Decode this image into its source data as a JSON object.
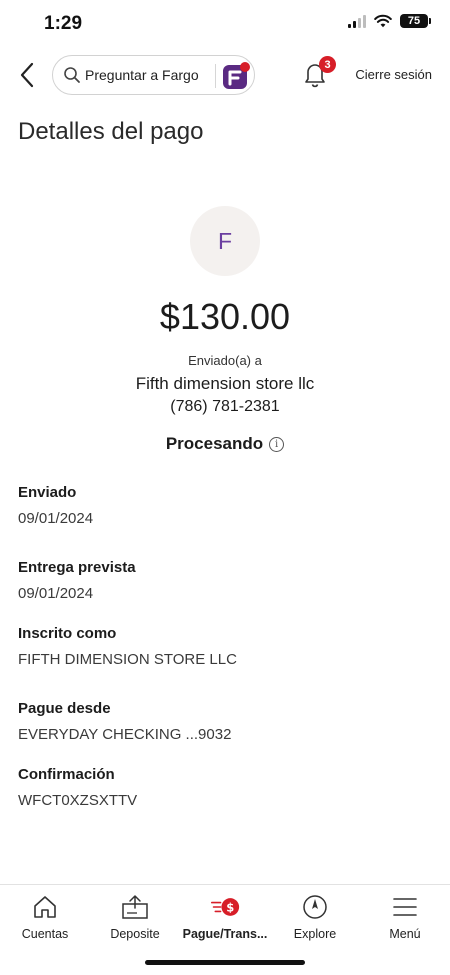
{
  "status_bar": {
    "time": "1:29",
    "battery": "75"
  },
  "header": {
    "search_placeholder": "Preguntar a Fargo",
    "notification_count": "3",
    "logout_label": "Cierre sesión"
  },
  "page": {
    "title": "Detalles del pago"
  },
  "payment": {
    "avatar_initial": "F",
    "amount": "$130.00",
    "sent_to_label": "Enviado(a) a",
    "recipient_name": "Fifth dimension store llc",
    "recipient_phone": "(786) 781-2381",
    "status": "Procesando"
  },
  "details": [
    {
      "label": "Enviado",
      "value": "09/01/2024"
    },
    {
      "label": "Entrega prevista",
      "value": "09/01/2024"
    },
    {
      "label": "Inscrito como",
      "value": "FIFTH DIMENSION STORE LLC"
    },
    {
      "label": "Pague desde",
      "value": "EVERYDAY CHECKING ...9032"
    },
    {
      "label": "Confirmación",
      "value": "WFCT0XZSXTTV"
    }
  ],
  "bottom_nav": [
    {
      "label": "Cuentas",
      "icon": "home-icon"
    },
    {
      "label": "Deposite",
      "icon": "deposit-icon"
    },
    {
      "label": "Pague/Trans...",
      "icon": "pay-transfer-icon",
      "active": true
    },
    {
      "label": "Explore",
      "icon": "compass-icon"
    },
    {
      "label": "Menú",
      "icon": "menu-icon"
    }
  ],
  "colors": {
    "brand_red": "#d71e28",
    "fargo_purple": "#5a2a82",
    "avatar_text": "#6b3fa0",
    "avatar_bg": "#f4f1ef"
  }
}
